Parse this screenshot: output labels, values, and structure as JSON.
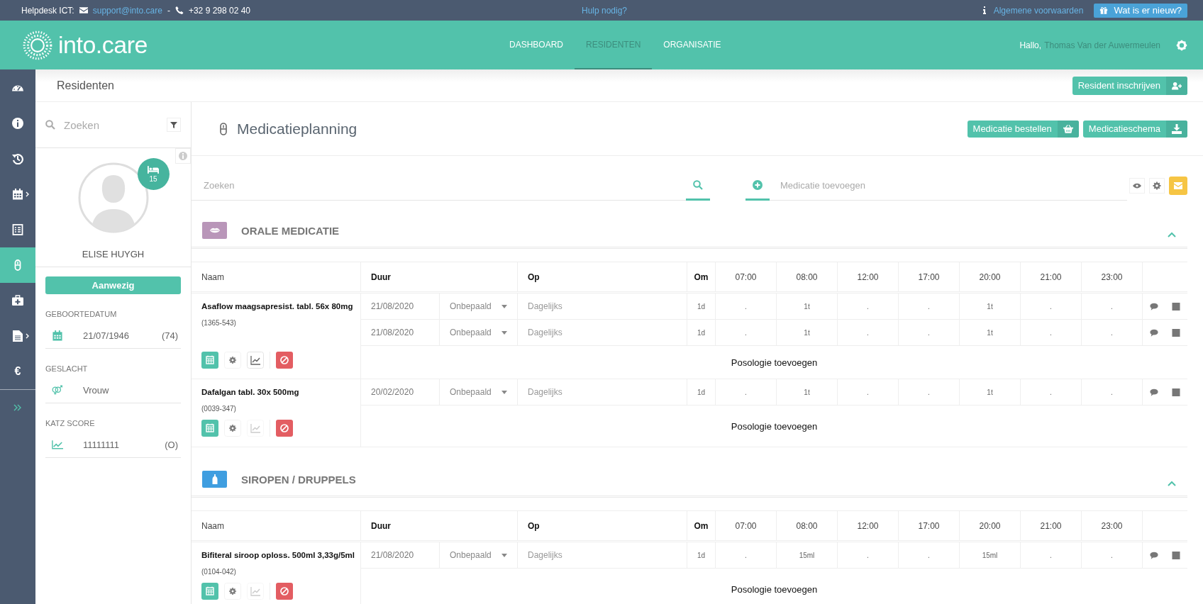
{
  "topbar": {
    "helpdesk_label": "Helpdesk ICT:",
    "email": "support@into.care",
    "separator": "-",
    "phone": "+32 9 298 02 40",
    "help_link": "Hulp nodig?",
    "terms_link": "Algemene voorwaarden",
    "whats_new_button": "Wat is er nieuw?"
  },
  "header": {
    "logo": "into.care",
    "nav": [
      {
        "label": "DASHBOARD",
        "selected": false
      },
      {
        "label": "RESIDENTEN",
        "selected": true
      },
      {
        "label": "ORGANISATIE",
        "selected": false
      }
    ],
    "greeting": "Hallo,",
    "user": "Thomas Van der Auwermeulen"
  },
  "rail": {
    "items": [
      {
        "kind": "dashboard",
        "selected": false,
        "submenu": false
      },
      {
        "kind": "info",
        "selected": false,
        "submenu": false
      },
      {
        "kind": "history",
        "selected": false,
        "submenu": false
      },
      {
        "kind": "calendar",
        "selected": false,
        "submenu": true
      },
      {
        "kind": "checklist",
        "selected": false,
        "submenu": false
      },
      {
        "kind": "pill",
        "selected": true,
        "submenu": false
      },
      {
        "kind": "medkit",
        "selected": false,
        "submenu": false
      },
      {
        "kind": "document",
        "selected": false,
        "submenu": true
      },
      {
        "kind": "euro",
        "glyph": "€",
        "selected": false,
        "submenu": false
      }
    ]
  },
  "breadcrumb": "Residenten",
  "enroll_button": "Resident inschrijven",
  "resident": {
    "search_placeholder": "Zoeken",
    "room": "15",
    "name": "ELISE HUYGH",
    "status_button": "Aanwezig",
    "fields": [
      {
        "kind": "birthdate",
        "label": "GEBOORTEDATUM",
        "value": "21/07/1946",
        "extra": "(74)"
      },
      {
        "kind": "gender",
        "label": "GESLACHT",
        "value": "Vrouw"
      },
      {
        "kind": "katz",
        "label": "KATZ SCORE",
        "value": "11111111",
        "extra": "(O)"
      }
    ]
  },
  "page": {
    "title": "Medicatieplanning",
    "buttons": [
      {
        "kind": "basket",
        "label": "Medicatie bestellen"
      },
      {
        "kind": "download",
        "label": "Medicatieschema"
      }
    ],
    "search_placeholder": "Zoeken",
    "add_placeholder": "Medicatie toevoegen"
  },
  "sections": [
    {
      "kind": "oral",
      "title": "ORALE MEDICATIE",
      "color": "#b996b9",
      "columns": [
        "Naam",
        "Duur",
        "Op",
        "Om",
        "07:00",
        "08:00",
        "12:00",
        "17:00",
        "20:00",
        "21:00",
        "23:00"
      ],
      "medications": [
        {
          "name": "Asaflow maagsapresist. tabl. 56x 80mg",
          "code": "(1365-543)",
          "chart_enabled": true,
          "add_label": "Posologie toevoegen",
          "schedules": [
            {
              "start": "21/08/2020",
              "duration": "Onbepaald",
              "frequency": "Dagelijks",
              "interval": "1d",
              "doses": [
                ".",
                "1t",
                ".",
                ".",
                "1t",
                ".",
                "."
              ]
            },
            {
              "start": "21/08/2020",
              "duration": "Onbepaald",
              "frequency": "Dagelijks",
              "interval": "1d",
              "doses": [
                ".",
                "1t",
                ".",
                ".",
                "1t",
                ".",
                "."
              ]
            }
          ]
        },
        {
          "name": "Dafalgan tabl. 30x 500mg",
          "code": "(0039-347)",
          "chart_enabled": false,
          "add_label": "Posologie toevoegen",
          "schedules": [
            {
              "start": "20/02/2020",
              "duration": "Onbepaald",
              "frequency": "Dagelijks",
              "interval": "1d",
              "doses": [
                ".",
                "1t",
                ".",
                ".",
                "1t",
                ".",
                "."
              ]
            }
          ]
        }
      ]
    },
    {
      "kind": "syrup",
      "title": "SIROPEN / DRUPPELS",
      "color": "#3f9ee0",
      "columns": [
        "Naam",
        "Duur",
        "Op",
        "Om",
        "07:00",
        "08:00",
        "12:00",
        "17:00",
        "20:00",
        "21:00",
        "23:00"
      ],
      "medications": [
        {
          "name": "Bifiteral siroop oploss. 500ml 3,33g/5ml",
          "code": "(0104-042)",
          "chart_enabled": false,
          "add_label": "Posologie toevoegen",
          "schedules": [
            {
              "start": "21/08/2020",
              "duration": "Onbepaald",
              "frequency": "Dagelijks",
              "interval": "1d",
              "doses": [
                ".",
                "15ml",
                ".",
                ".",
                "15ml",
                ".",
                "."
              ]
            }
          ]
        }
      ]
    }
  ]
}
